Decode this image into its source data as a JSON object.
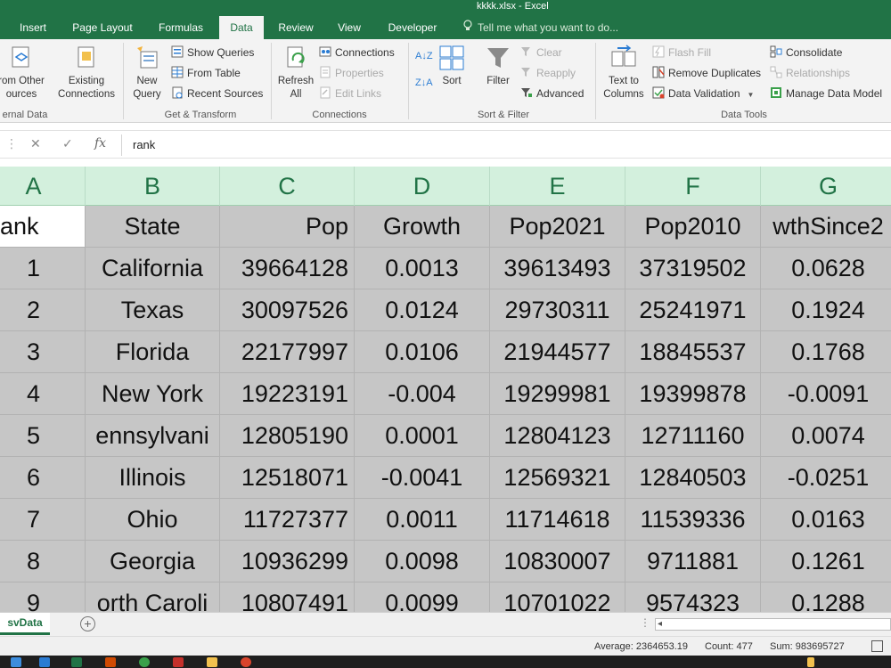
{
  "window": {
    "title": "kkkk.xlsx - Excel"
  },
  "tabs": [
    {
      "label": "Insert"
    },
    {
      "label": "Page Layout"
    },
    {
      "label": "Formulas"
    },
    {
      "label": "Data",
      "active": true
    },
    {
      "label": "Review"
    },
    {
      "label": "View"
    },
    {
      "label": "Developer"
    }
  ],
  "tell_me": {
    "placeholder": "Tell me what you want to do..."
  },
  "ribbon": {
    "get_external": {
      "button_line1": "rom Other",
      "button_line2": "ources",
      "group_label": "ernal Data"
    },
    "existing_connections": {
      "line1": "Existing",
      "line2": "Connections"
    },
    "new_query": {
      "line1": "New",
      "line2": "Query"
    },
    "show_queries": "Show Queries",
    "from_table": "From Table",
    "recent_sources": "Recent Sources",
    "get_transform_label": "Get & Transform",
    "refresh_all": {
      "line1": "Refresh",
      "line2": "All"
    },
    "connections": "Connections",
    "properties": "Properties",
    "edit_links": "Edit Links",
    "connections_label": "Connections",
    "sort": "Sort",
    "filter": "Filter",
    "clear": "Clear",
    "reapply": "Reapply",
    "advanced": "Advanced",
    "sort_filter_label": "Sort & Filter",
    "text_to_columns": {
      "line1": "Text to",
      "line2": "Columns"
    },
    "flash_fill": "Flash Fill",
    "remove_duplicates": "Remove Duplicates",
    "data_validation": "Data Validation",
    "consolidate": "Consolidate",
    "relationships": "Relationships",
    "manage_data_model": "Manage Data Model",
    "data_tools_label": "Data Tools"
  },
  "formula_bar": {
    "cancel": "✕",
    "enter": "✓",
    "fx": "fx",
    "content": "rank"
  },
  "columns": [
    "A",
    "B",
    "C",
    "D",
    "E",
    "F",
    "G"
  ],
  "header_row": [
    "ank",
    "State",
    "Pop",
    "Growth",
    "Pop2021",
    "Pop2010",
    "wthSince2"
  ],
  "rows": [
    [
      "1",
      "California",
      "39664128",
      "0.0013",
      "39613493",
      "37319502",
      "0.0628"
    ],
    [
      "2",
      "Texas",
      "30097526",
      "0.0124",
      "29730311",
      "25241971",
      "0.1924"
    ],
    [
      "3",
      "Florida",
      "22177997",
      "0.0106",
      "21944577",
      "18845537",
      "0.1768"
    ],
    [
      "4",
      "New York",
      "19223191",
      "-0.004",
      "19299981",
      "19399878",
      "-0.0091"
    ],
    [
      "5",
      "ennsylvani",
      "12805190",
      "0.0001",
      "12804123",
      "12711160",
      "0.0074"
    ],
    [
      "6",
      "Illinois",
      "12518071",
      "-0.0041",
      "12569321",
      "12840503",
      "-0.0251"
    ],
    [
      "7",
      "Ohio",
      "11727377",
      "0.0011",
      "11714618",
      "11539336",
      "0.0163"
    ],
    [
      "8",
      "Georgia",
      "10936299",
      "0.0098",
      "10830007",
      "9711881",
      "0.1261"
    ],
    [
      "9",
      "orth Caroli",
      "10807491",
      "0.0099",
      "10701022",
      "9574323",
      "0.1288"
    ]
  ],
  "sheet_tab": "svData",
  "status": {
    "average": "Average: 2364653.19",
    "count": "Count: 477",
    "sum": "Sum: 983695727"
  },
  "colors": {
    "excel_green": "#217346",
    "header_green": "#d3f0dd",
    "cell_gray": "#c6c6c6"
  }
}
